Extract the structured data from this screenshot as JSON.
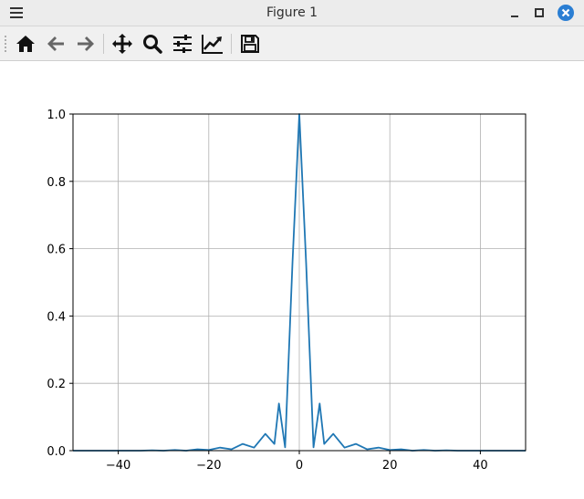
{
  "window": {
    "title": "Figure 1"
  },
  "toolbar": {
    "buttons": [
      {
        "name": "home",
        "icon": "home-icon"
      },
      {
        "name": "back",
        "icon": "arrow-left-icon"
      },
      {
        "name": "forward",
        "icon": "arrow-right-icon"
      },
      {
        "name": "pan",
        "icon": "move-icon"
      },
      {
        "name": "zoom",
        "icon": "zoom-icon"
      },
      {
        "name": "configure-subplots",
        "icon": "sliders-icon"
      },
      {
        "name": "edit-axis",
        "icon": "chart-line-icon"
      },
      {
        "name": "save",
        "icon": "save-icon"
      }
    ]
  },
  "colors": {
    "line": "#1f77b4",
    "grid": "#b0b0b0",
    "close": "#2a7ed3"
  },
  "chart_data": {
    "type": "line",
    "title": "",
    "xlabel": "",
    "ylabel": "",
    "xlim": [
      -50,
      50
    ],
    "ylim": [
      0,
      1.0
    ],
    "grid": true,
    "x_ticks": [
      -40,
      -20,
      0,
      20,
      40
    ],
    "x_tick_labels": [
      "−40",
      "−20",
      "0",
      "20",
      "40"
    ],
    "y_ticks": [
      0,
      0.2,
      0.4,
      0.6,
      0.8,
      1.0
    ],
    "y_tick_labels": [
      "0.0",
      "0.2",
      "0.4",
      "0.6",
      "0.8",
      "1.0"
    ],
    "series": [
      {
        "x": [
          -50,
          -45,
          -40,
          -35,
          -32.5,
          -30,
          -27.5,
          -25,
          -22.5,
          -20,
          -17.5,
          -15,
          -12.5,
          -10,
          -7.5,
          -5.5,
          -4.5,
          -3.14,
          -1.5,
          0,
          1.5,
          3.14,
          4.5,
          5.5,
          7.5,
          10,
          12.5,
          15,
          17.5,
          20,
          22.5,
          25,
          27.5,
          30,
          32.5,
          35,
          40,
          45,
          50
        ],
        "y": [
          0.0,
          0.0,
          0.0,
          0.0,
          0.001,
          0.0,
          0.002,
          0.0,
          0.004,
          0.002,
          0.009,
          0.004,
          0.02,
          0.009,
          0.05,
          0.02,
          0.14,
          0.01,
          0.56,
          1.0,
          0.56,
          0.01,
          0.14,
          0.02,
          0.05,
          0.009,
          0.02,
          0.004,
          0.009,
          0.002,
          0.004,
          0.0,
          0.002,
          0.0,
          0.001,
          0.0,
          0.0,
          0.0,
          0.0
        ]
      }
    ]
  }
}
